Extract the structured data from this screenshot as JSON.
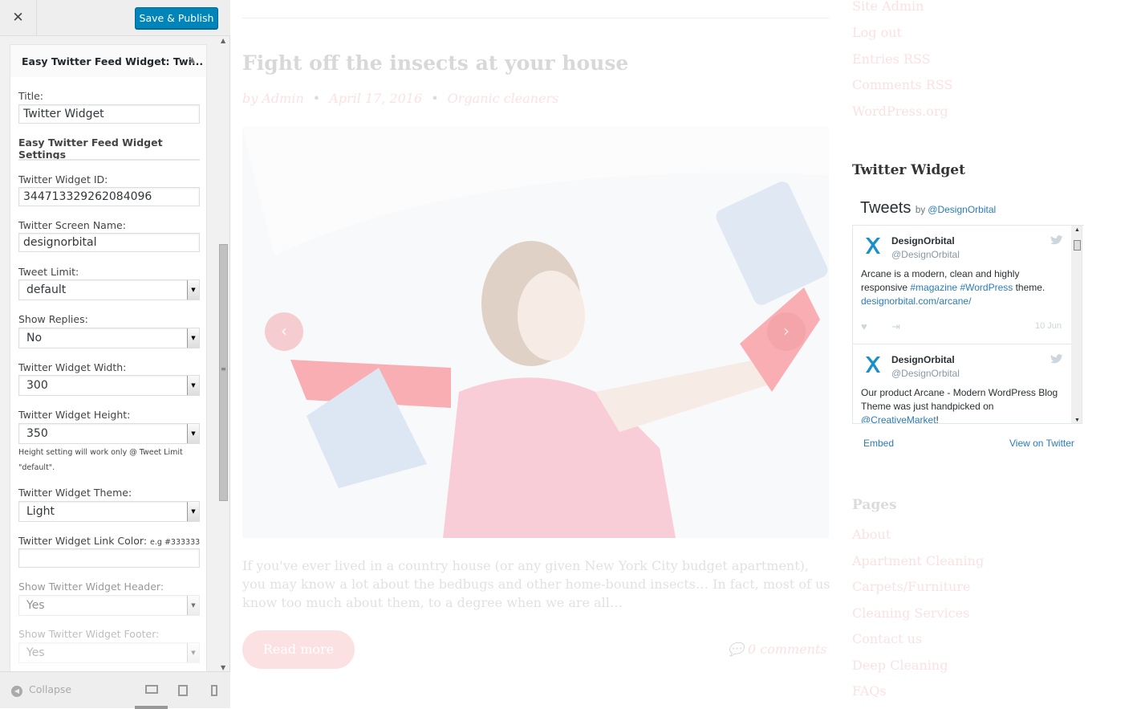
{
  "panel": {
    "close_icon": "close-icon",
    "save_label": "Save & Publish",
    "widget_title": "Easy Twitter Feed Widget: Twi...",
    "collapse_label": "Collapse",
    "fields": {
      "title_label": "Title:",
      "title_value": "Twitter Widget",
      "section_heading": "Easy Twitter Feed Widget Settings",
      "widget_id_label": "Twitter Widget ID:",
      "widget_id_value": "344713329262084096",
      "screen_name_label": "Twitter Screen Name:",
      "screen_name_value": "designorbital",
      "tweet_limit_label": "Tweet Limit:",
      "tweet_limit_value": "default",
      "show_replies_label": "Show Replies:",
      "show_replies_value": "No",
      "width_label": "Twitter Widget Width:",
      "width_value": "300",
      "height_label": "Twitter Widget Height:",
      "height_value": "350",
      "height_note": "Height setting will work only @ Tweet Limit \"default\".",
      "theme_label": "Twitter Widget Theme:",
      "theme_value": "Light",
      "link_color_label": "Twitter Widget Link Color:",
      "link_color_hint": "e.g #333333",
      "link_color_value": "",
      "show_header_label": "Show Twitter Widget Header:",
      "show_header_value": "Yes",
      "show_footer_label": "Show Twitter Widget Footer:",
      "show_footer_value": "Yes"
    }
  },
  "preview": {
    "post_title": "Fight off the insects at your house",
    "post_author": "by Admin",
    "post_date": "April 17, 2016",
    "post_category": "Organic cleaners",
    "excerpt": "If you've ever lived in a country house (or any given New York City budget apartment), you may know a lot about the bedbugs and other home-bound insects… In fact, most of us know too much about them, to a degree when we are all…",
    "read_more": "Read more",
    "comments": "0 comments",
    "meta_links": [
      "Site Admin",
      "Log out",
      "Entries RSS",
      "Comments RSS",
      "WordPress.org"
    ],
    "twitter_widget_heading": "Twitter Widget",
    "pages_heading": "Pages",
    "pages": [
      "About",
      "Apartment Cleaning",
      "Carpets/Furniture",
      "Cleaning Services",
      "Contact us",
      "Deep Cleaning",
      "FAQs"
    ],
    "timeline": {
      "title": "Tweets",
      "by": "by",
      "handle": "@DesignOrbital",
      "tweets": [
        {
          "name": "DesignOrbital",
          "handle": "@DesignOrbital",
          "text_pre": "Arcane is a modern, clean and highly responsive ",
          "tag1": "#magazine",
          "tag2": "#WordPress",
          "text_post": " theme.",
          "link": "designorbital.com/arcane/",
          "date": "10 Jun"
        },
        {
          "name": "DesignOrbital",
          "handle": "@DesignOrbital",
          "text_pre": "Our product Arcane - Modern WordPress Blog Theme was just handpicked on ",
          "mention": "@CreativeMarket",
          "text_post": "!"
        }
      ],
      "embed": "Embed",
      "view_on_twitter": "View on Twitter"
    }
  },
  "colors": {
    "primary_button": "#0085ba",
    "accent": "#e8565e",
    "twitter_link": "#2b7bb9"
  }
}
